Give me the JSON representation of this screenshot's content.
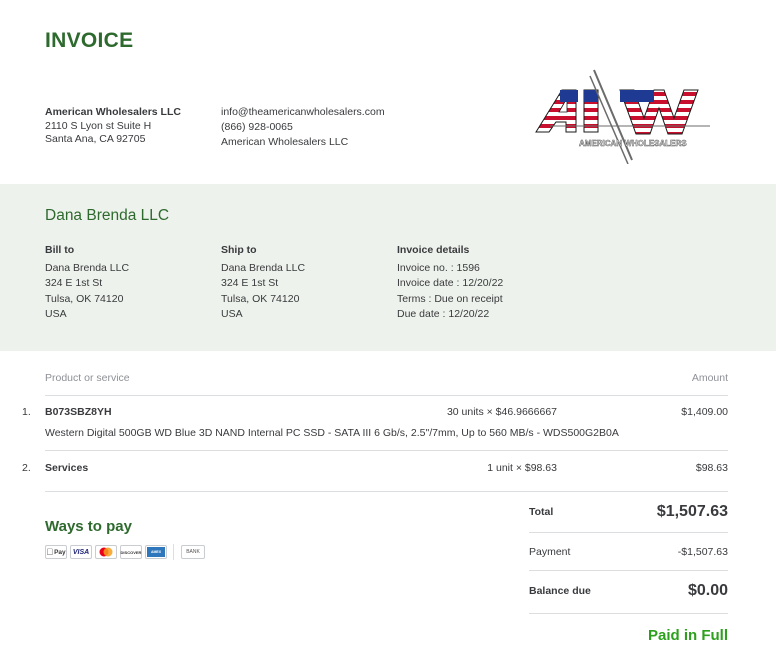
{
  "header": {
    "title": "INVOICE"
  },
  "seller": {
    "name": "American Wholesalers LLC",
    "address1": "2110 S Lyon st Suite H",
    "address2": "Santa Ana, CA 92705",
    "email": "info@theamericanwholesalers.com",
    "phone": "(866) 928-0065",
    "display_name": "American Wholesalers LLC",
    "logo_text": "AMERICAN WHOLESALERS"
  },
  "customer": {
    "name": "Dana Brenda LLC"
  },
  "bill_to": {
    "heading": "Bill to",
    "lines": [
      "Dana Brenda LLC",
      "324 E 1st St",
      "Tulsa, OK 74120",
      "USA"
    ]
  },
  "ship_to": {
    "heading": "Ship to",
    "lines": [
      "Dana Brenda LLC",
      "324 E 1st St",
      "Tulsa, OK 74120",
      "USA"
    ]
  },
  "invoice_details": {
    "heading": "Invoice details",
    "lines": [
      "Invoice no. : 1596",
      "Invoice date : 12/20/22",
      "Terms : Due on receipt",
      "Due date : 12/20/22"
    ]
  },
  "table": {
    "col_product": "Product or service",
    "col_amount": "Amount",
    "items": [
      {
        "num": "1.",
        "name": "B073SBZ8YH",
        "qty": "30 units × $46.9666667",
        "amount": "$1,409.00",
        "description": "Western Digital 500GB WD Blue 3D NAND Internal PC SSD - SATA III 6 Gb/s, 2.5\"/7mm, Up to 560 MB/s - WDS500G2B0A"
      },
      {
        "num": "2.",
        "name": "Services",
        "qty": "1 unit × $98.63",
        "amount": "$98.63",
        "description": ""
      }
    ]
  },
  "ways_to_pay": {
    "title": "Ways to pay",
    "methods": [
      "Pay",
      "VISA",
      "DISCOVER",
      "AMEX",
      "BANK"
    ]
  },
  "totals": {
    "total_label": "Total",
    "total_value": "$1,507.63",
    "payment_label": "Payment",
    "payment_value": "-$1,507.63",
    "balance_label": "Balance due",
    "balance_value": "$0.00",
    "status": "Paid in Full"
  },
  "colors": {
    "brand_green": "#2e6a2e",
    "paid_green": "#2ca01c",
    "band_bg": "#eef2ec"
  }
}
